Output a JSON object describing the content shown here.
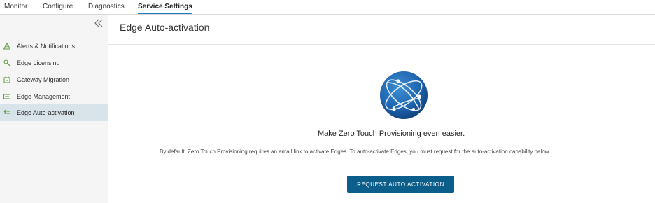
{
  "top_tabs": [
    {
      "label": "Monitor"
    },
    {
      "label": "Configure"
    },
    {
      "label": "Diagnostics"
    },
    {
      "label": "Service Settings",
      "active": true
    }
  ],
  "sidebar": {
    "items": [
      {
        "label": "Alerts & Notifications",
        "icon": "alert-triangle-icon"
      },
      {
        "label": "Edge Licensing",
        "icon": "key-icon"
      },
      {
        "label": "Gateway Migration",
        "icon": "migration-icon"
      },
      {
        "label": "Edge Management",
        "icon": "edge-management-icon"
      },
      {
        "label": "Edge Auto-activation",
        "icon": "auto-activation-icon",
        "selected": true
      }
    ]
  },
  "page": {
    "title": "Edge Auto-activation",
    "headline": "Make Zero Touch Provisioning even easier.",
    "description": "By default, Zero Touch Provisioning requires an email link to activate Edges. To auto-activate Edges, you must request for the auto-activation capability below.",
    "button_label": "REQUEST AUTO ACTIVATION"
  },
  "colors": {
    "accent": "#1b7cc2",
    "button": "#0b5e8a",
    "sidebar_selected": "#d8e3ea",
    "icon_green": "#5a9a3a"
  }
}
